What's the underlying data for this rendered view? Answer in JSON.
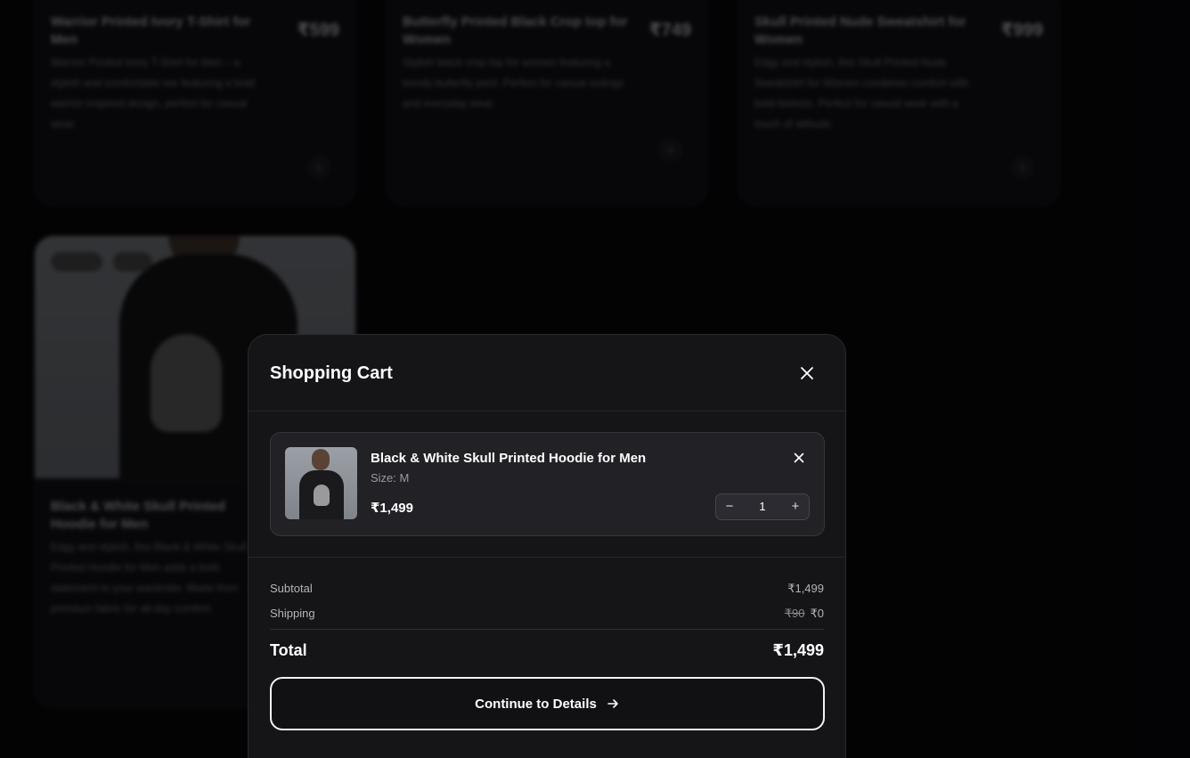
{
  "background": {
    "products": [
      {
        "title": "Warrior Printed Ivory T-Shirt for Men",
        "price": "₹599",
        "desc": "Warrior Printed Ivory T-Shirt for Men – a stylish and comfortable tee featuring a bold warrior-inspired design, perfect for casual wear."
      },
      {
        "title": "Butterfly Printed Black Crop top for Women",
        "price": "₹749",
        "desc": "Stylish black crop top for women featuring a trendy butterfly print. Perfect for casual outings and everyday wear."
      },
      {
        "title": "Skull Printed Nude Sweatshirt for Women",
        "price": "₹999",
        "desc": "Edgy and stylish, this Skull Printed Nude Sweatshirt for Women combines comfort with bold fashion. Perfect for casual wear with a touch of attitude."
      },
      {
        "title": "Black & White Skull Printed Hoodie for Men",
        "price": "",
        "desc": "Edgy and stylish, this Black & White Skull Printed Hoodie for Men adds a bold statement to your wardrobe. Made from premium fabric for all-day comfort."
      }
    ]
  },
  "cart": {
    "title": "Shopping Cart",
    "item": {
      "name": "Black & White Skull Printed Hoodie for Men",
      "size": "Size: M",
      "price": "₹1,499",
      "quantity": "1",
      "minus": "−",
      "plus": "+"
    },
    "subtotal_label": "Subtotal",
    "subtotal_value": "₹1,499",
    "shipping_label": "Shipping",
    "shipping_original": "₹90",
    "shipping_value": "₹0",
    "total_label": "Total",
    "total_value": "₹1,499",
    "cta_label": "Continue to Details"
  }
}
